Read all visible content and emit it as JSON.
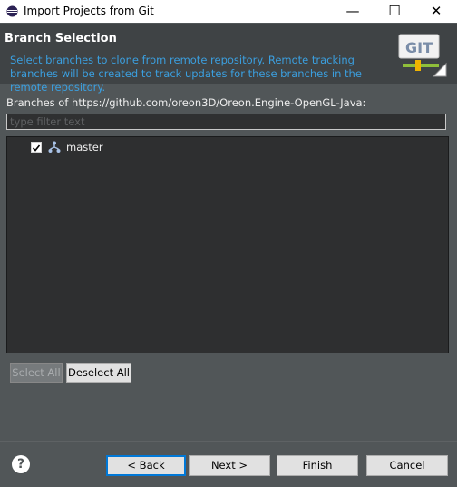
{
  "window": {
    "title": "Import Projects from Git",
    "controls": {
      "minimize": "—",
      "maximize": "☐",
      "close": "✕"
    }
  },
  "banner": {
    "heading": "Branch Selection",
    "description": "Select branches to clone from remote repository. Remote tracking branches will be created to track updates for these branches in the remote repository.",
    "logo_text": "GIT"
  },
  "branches": {
    "label": "Branches of https://github.com/oreon3D/Oreon.Engine-OpenGL-Java:",
    "filter_placeholder": "type filter text",
    "items": [
      {
        "label": "master",
        "checked": true,
        "icon": "branch-icon"
      }
    ]
  },
  "selection_buttons": {
    "select_all": "Select All",
    "deselect_all": "Deselect All"
  },
  "footer": {
    "help": "?",
    "back": "< Back",
    "next": "Next >",
    "finish": "Finish",
    "cancel": "Cancel"
  },
  "colors": {
    "banner_text": "#3b9fdf",
    "background": "#515658",
    "focus_border": "#0078d7"
  }
}
